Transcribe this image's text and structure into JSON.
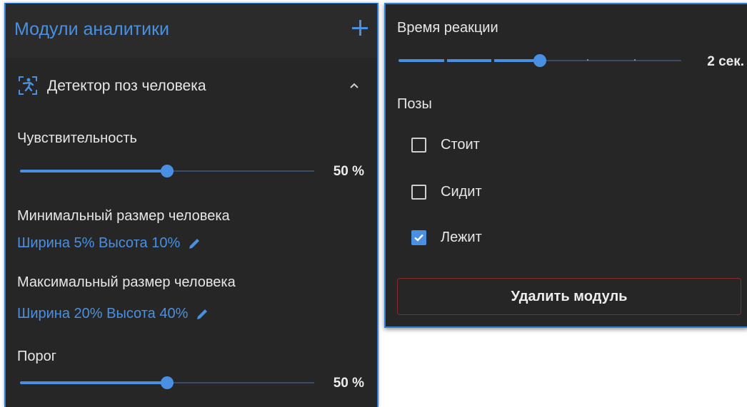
{
  "left": {
    "header_title": "Модули аналитики",
    "module": {
      "title": "Детектор поз человека"
    },
    "sensitivity": {
      "label": "Чувствительность",
      "value_text": "50 %",
      "value": 50
    },
    "min_size": {
      "label": "Минимальный размер человека",
      "link": "Ширина 5% Высота 10%"
    },
    "max_size": {
      "label": "Максимальный размер человека",
      "link": "Ширина 20% Высота 40%"
    },
    "threshold": {
      "label": "Порог",
      "value_text": "50 %",
      "value": 50
    }
  },
  "right": {
    "reaction": {
      "label": "Время реакции",
      "value_text": "2 сек.",
      "value": 0.5
    },
    "poses": {
      "label": "Позы",
      "items": [
        {
          "label": "Стоит",
          "checked": false
        },
        {
          "label": "Сидит",
          "checked": false
        },
        {
          "label": "Лежит",
          "checked": true
        }
      ]
    },
    "delete_label": "Удалить модуль"
  },
  "colors": {
    "accent": "#4a90e2",
    "panel_bg": "#262626",
    "danger_border": "#8a2a2a"
  },
  "icons": [
    "plus-icon",
    "person-pose-icon",
    "chevron-up-icon",
    "pencil-icon",
    "check-icon"
  ]
}
